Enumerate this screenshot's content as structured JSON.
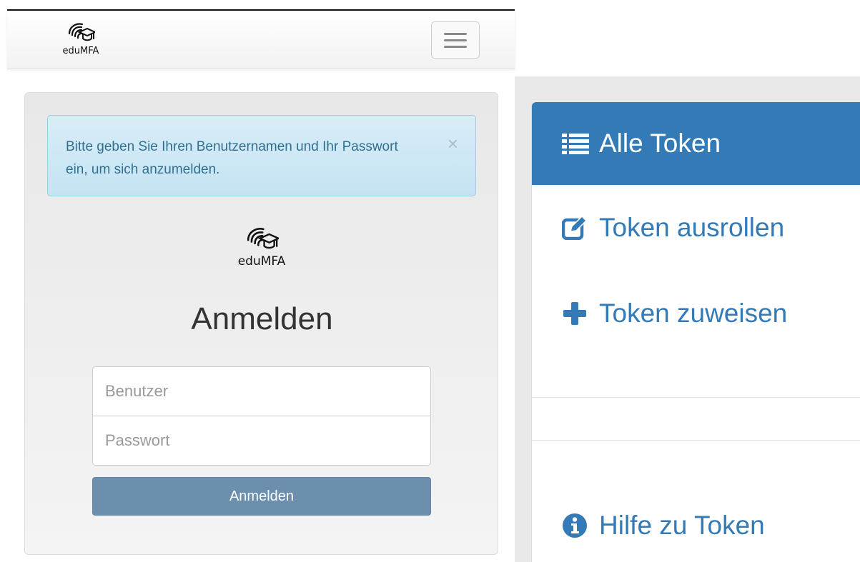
{
  "login": {
    "brand_text": "eduMFA",
    "alert_text": "Bitte geben Sie Ihren Benutzernamen und Ihr Passwort ein, um sich anzumelden.",
    "alert_close": "×",
    "logo_text": "eduMFA",
    "heading": "Anmelden",
    "username_placeholder": "Benutzer",
    "password_placeholder": "Passwort",
    "submit_label": "Anmelden"
  },
  "token_menu": {
    "items": [
      {
        "label": "Alle Token",
        "icon": "list-icon",
        "active": true
      },
      {
        "label": "Token ausrollen",
        "icon": "edit-icon",
        "active": false
      },
      {
        "label": "Token zuweisen",
        "icon": "plus-icon",
        "active": false
      },
      {
        "label": "Hilfe zu Token",
        "icon": "info-icon",
        "active": false
      }
    ]
  },
  "colors": {
    "accent": "#337ab7",
    "alert_bg": "#d9edf7",
    "alert_text": "#31708f",
    "button_bg": "#6c8fae"
  }
}
